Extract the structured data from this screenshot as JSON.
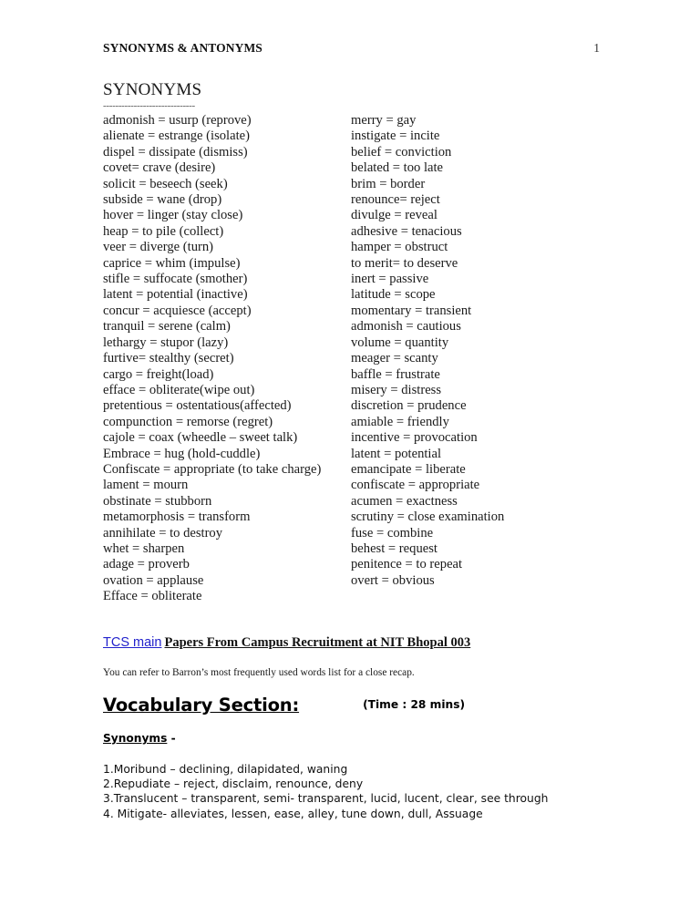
{
  "header": {
    "title": "SYNONYMS & ANTONYMS",
    "page_number": "1"
  },
  "section": {
    "title": "SYNONYMS",
    "rule": "------------------------------"
  },
  "synonyms": {
    "left_column": [
      "admonish = usurp (reprove)",
      "alienate = estrange (isolate)",
      "dispel = dissipate (dismiss)",
      "covet= crave (desire)",
      "solicit = beseech (seek)",
      "subside = wane (drop)",
      "hover = linger (stay close)",
      "heap = to pile (collect)",
      "veer = diverge (turn)",
      "caprice = whim (impulse)",
      "stifle = suffocate (smother)",
      "latent = potential (inactive)",
      "concur = acquiesce (accept)",
      "tranquil = serene (calm)",
      "lethargy = stupor (lazy)",
      "furtive= stealthy (secret)",
      "cargo = freight(load)",
      "efface = obliterate(wipe out)",
      "pretentious = ostentatious(affected)",
      "compunction = remorse (regret)",
      "cajole = coax (wheedle – sweet talk)",
      "Embrace = hug (hold-cuddle)",
      "Confiscate = appropriate (to take charge)",
      "lament = mourn",
      "obstinate = stubborn",
      "metamorphosis = transform",
      "annihilate = to destroy",
      "whet = sharpen",
      "adage = proverb",
      "ovation = applause",
      "Efface = obliterate"
    ],
    "right_column": [
      "merry = gay",
      "instigate = incite",
      "belief = conviction",
      "belated = too late",
      "brim = border",
      "renounce= reject",
      "divulge = reveal",
      "adhesive = tenacious",
      "hamper = obstruct",
      "to merit= to deserve",
      "inert = passive",
      "latitude = scope",
      "momentary = transient",
      "admonish = cautious",
      "volume = quantity",
      "meager = scanty",
      "baffle = frustrate",
      "misery = distress",
      "discretion = prudence",
      "amiable = friendly",
      "incentive = provocation",
      "latent = potential",
      "emancipate = liberate",
      "confiscate = appropriate",
      "acumen = exactness",
      "scrutiny = close examination",
      "fuse = combine",
      "behest = request",
      "penitence = to repeat",
      "overt = obvious"
    ]
  },
  "tcs": {
    "link_text": "TCS main",
    "heading_rest": "Papers From Campus Recruitment at NIT Bhopal 003",
    "link_color": "#2222cc",
    "note": "You can refer to Barron’s most frequently used words list for a close recap."
  },
  "vocabulary": {
    "heading": "Vocabulary Section:",
    "time": "(Time : 28 mins)",
    "sub_label": "Synonyms",
    "sub_label_dash": " -",
    "items": [
      "1.Moribund – declining, dilapidated, waning",
      "2.Repudiate – reject, disclaim, renounce, deny",
      "3.Translucent – transparent, semi- transparent, lucid, lucent, clear, see through",
      "4. Mitigate- alleviates, lessen, ease, alley, tune down, dull, Assuage"
    ]
  }
}
